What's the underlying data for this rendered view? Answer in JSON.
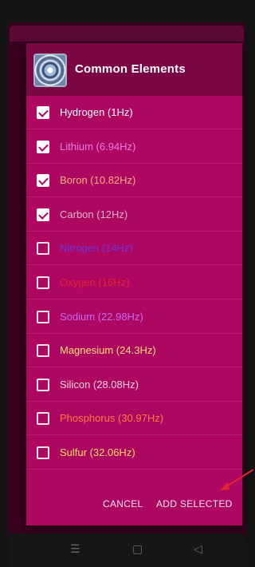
{
  "dialog": {
    "title": "Common Elements",
    "icon": "mandala-image",
    "elements": [
      {
        "label": "Hydrogen (1Hz)",
        "checked": true,
        "color": "#ffffff"
      },
      {
        "label": "Lithium (6.94Hz)",
        "checked": true,
        "color": "#e77ee0"
      },
      {
        "label": "Boron (10.82Hz)",
        "checked": true,
        "color": "#ffb27a"
      },
      {
        "label": "Carbon (12Hz)",
        "checked": true,
        "color": "#d6b9c6"
      },
      {
        "label": "Nitrogen (14Hz)",
        "checked": false,
        "color": "#6a35d6"
      },
      {
        "label": "Oxygen (16Hz)",
        "checked": false,
        "color": "#e5232b"
      },
      {
        "label": "Sodium (22.98Hz)",
        "checked": false,
        "color": "#c46bf0"
      },
      {
        "label": "Magnesium (24.3Hz)",
        "checked": false,
        "color": "#ffe071"
      },
      {
        "label": "Silicon (28.08Hz)",
        "checked": false,
        "color": "#f3d3df"
      },
      {
        "label": "Phosphorus (30.97Hz)",
        "checked": false,
        "color": "#ff7a3a"
      },
      {
        "label": "Sulfur (32.06Hz)",
        "checked": false,
        "color": "#ffde5c"
      }
    ],
    "actions": {
      "cancel_label": "CANCEL",
      "add_selected_label": "ADD SELECTED"
    }
  },
  "colors": {
    "dialog_bg": "#ad0762",
    "header_bg": "#7a0744",
    "annotation_arrow": "#e8242b"
  },
  "nav": {
    "menu_glyph": "☰",
    "home_glyph": "▢",
    "back_glyph": "◁"
  }
}
